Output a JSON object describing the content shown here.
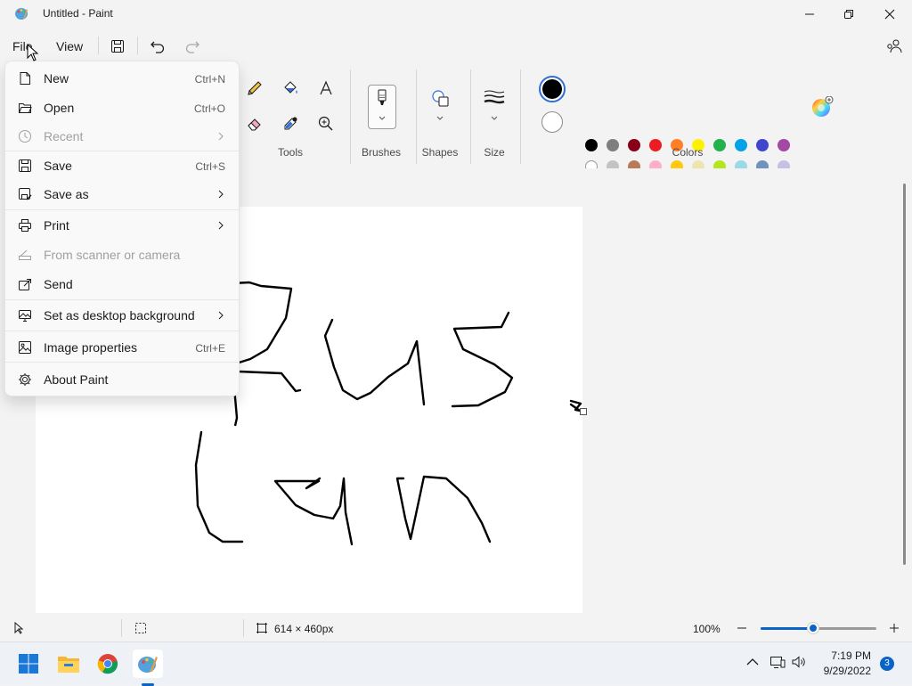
{
  "window": {
    "title": "Untitled - Paint",
    "app_icon": "paint-palette-icon",
    "controls": [
      "minimize-icon",
      "restore-icon",
      "close-icon"
    ]
  },
  "menubar": {
    "file_label": "File",
    "view_label": "View",
    "quick_actions": [
      "save-icon",
      "undo-icon",
      "redo-icon"
    ],
    "right_icon": "account-share-icon"
  },
  "ribbon": {
    "tools_label": "Tools",
    "tools": [
      "pencil-icon",
      "fill-bucket-icon",
      "text-icon",
      "eraser-icon",
      "color-picker-icon",
      "magnifier-icon"
    ],
    "brushes_label": "Brushes",
    "shapes_label": "Shapes",
    "size_label": "Size",
    "colors_label": "Colors",
    "primary_color": "#000000",
    "secondary_color": "#ffffff",
    "palette_row1": [
      "#000000",
      "#7f7f7f",
      "#880015",
      "#ed1c24",
      "#ff7f27",
      "#fff200",
      "#22b14c",
      "#00a2e8",
      "#3f48cc",
      "#a349a4"
    ],
    "palette_row2": [
      "#ffffff",
      "#c3c3c3",
      "#b97a57",
      "#ffaec9",
      "#ffc90e",
      "#efe4b0",
      "#b5e61d",
      "#99d9ea",
      "#7092be",
      "#c8bfe7"
    ],
    "edit_colors_icon": "color-wheel-icon"
  },
  "file_menu": {
    "items": [
      {
        "label": "New",
        "shortcut": "Ctrl+N",
        "icon": "new-file-icon"
      },
      {
        "label": "Open",
        "shortcut": "Ctrl+O",
        "icon": "folder-open-icon"
      },
      {
        "label": "Recent",
        "shortcut": "",
        "icon": "clock-icon"
      },
      {
        "label": "Save",
        "shortcut": "Ctrl+S",
        "icon": "save-icon"
      },
      {
        "label": "Save as",
        "shortcut": "",
        "icon": "save-as-icon"
      },
      {
        "label": "Print",
        "shortcut": "",
        "icon": "printer-icon"
      },
      {
        "label": "From scanner or camera",
        "shortcut": "",
        "icon": "scanner-icon"
      },
      {
        "label": "Send",
        "shortcut": "",
        "icon": "share-icon"
      },
      {
        "label": "Set as desktop background",
        "shortcut": "",
        "icon": "desktop-background-icon"
      },
      {
        "label": "Image properties",
        "shortcut": "Ctrl+E",
        "icon": "image-properties-icon"
      },
      {
        "label": "About Paint",
        "shortcut": "",
        "icon": "gear-icon"
      }
    ]
  },
  "canvas": {
    "size_text": "614 × 460px"
  },
  "statusbar": {
    "zoom_text": "100%",
    "zoom_fraction": 0.45
  },
  "taskbar": {
    "apps": [
      "windows-start-icon",
      "file-explorer-icon",
      "chrome-icon",
      "paint-icon"
    ],
    "time": "7:19 PM",
    "date": "9/29/2022",
    "notification_count": "3"
  }
}
